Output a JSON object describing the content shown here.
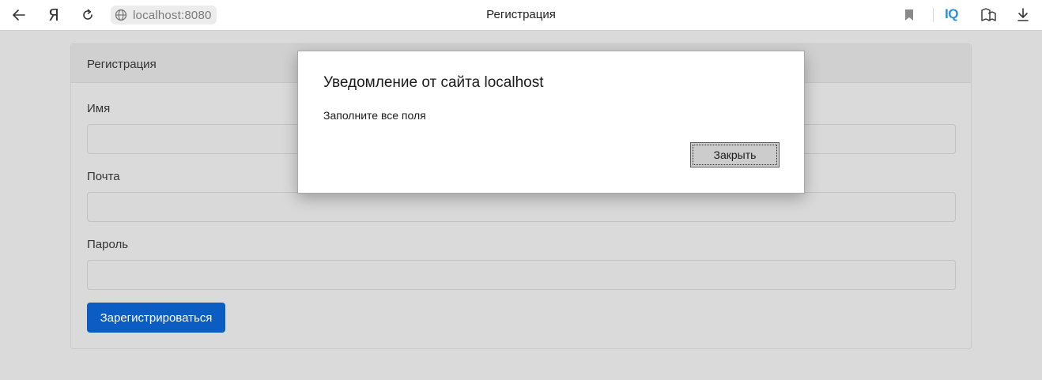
{
  "browser": {
    "url": "localhost:8080",
    "tab_title": "Регистрация",
    "brand_icon": "Я",
    "iq_label": "IQ",
    "icons": [
      "back-arrow-icon",
      "yandex-icon",
      "reload-icon",
      "globe-icon",
      "bookmark-icon",
      "iq-icon",
      "collections-icon",
      "download-icon"
    ]
  },
  "card": {
    "header": "Регистрация",
    "fields": [
      {
        "label": "Имя",
        "value": ""
      },
      {
        "label": "Почта",
        "value": ""
      },
      {
        "label": "Пароль",
        "value": ""
      }
    ],
    "submit_label": "Зарегистрироваться",
    "accent_color": "#0b5cc3"
  },
  "dialog": {
    "title": "Уведомление от сайта localhost",
    "message": "Заполните все поля",
    "button_label": "Закрыть"
  }
}
